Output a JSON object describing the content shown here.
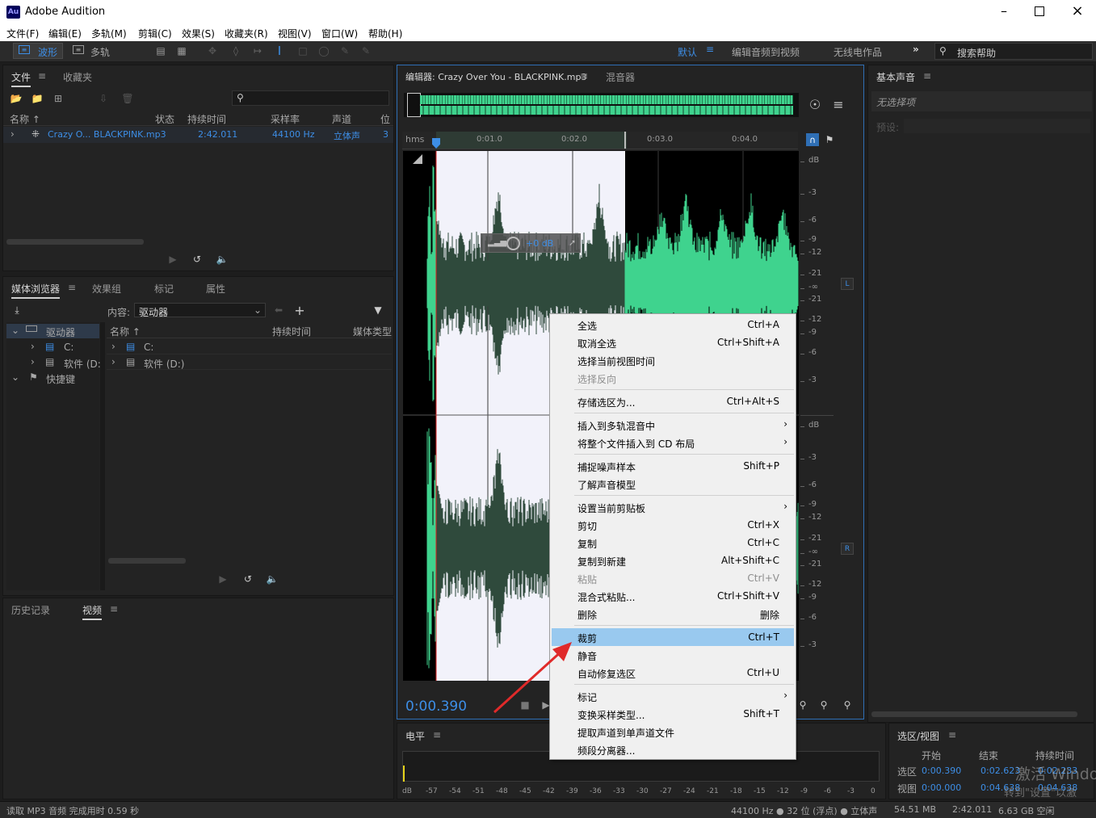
{
  "window": {
    "title": "Adobe Audition",
    "app_icon": "Au"
  },
  "menubar": [
    "文件(F)",
    "编辑(E)",
    "多轨(M)",
    "剪辑(C)",
    "效果(S)",
    "收藏夹(R)",
    "视图(V)",
    "窗口(W)",
    "帮助(H)"
  ],
  "toolbar": {
    "waveform": "波形",
    "multitrack": "多轨",
    "workspace_default": "默认",
    "ws_edit_video": "编辑音频到视频",
    "ws_radio": "无线电作品",
    "search_placeholder": "搜索帮助"
  },
  "files_panel": {
    "tabs": [
      "文件",
      "收藏夹"
    ],
    "columns": [
      "名称",
      "状态",
      "持续时间",
      "采样率",
      "声道",
      "位"
    ],
    "rows": [
      {
        "name": "Crazy O... BLACKPINK.mp3",
        "duration": "2:42.011",
        "rate": "44100 Hz",
        "channels": "立体声",
        "bits": "3"
      }
    ]
  },
  "media_panel": {
    "tabs": [
      "媒体浏览器",
      "效果组",
      "标记",
      "属性"
    ],
    "content_label": "内容:",
    "content_value": "驱动器",
    "tree": [
      "驱动器",
      "C:",
      "软件 (D:",
      "快捷键"
    ],
    "columns": [
      "名称",
      "持续时间",
      "媒体类型"
    ],
    "rows": [
      "C:",
      "软件 (D:)"
    ]
  },
  "history_panel": {
    "tabs": [
      "历史记录",
      "视频"
    ]
  },
  "editor": {
    "tab_editor": "编辑器: Crazy Over You - BLACKPINK.mp3",
    "tab_mixer": "混音器",
    "ruler_unit": "hms",
    "ruler_ticks": [
      "0:01.0",
      "0:02.0",
      "0:03.0",
      "0:04.0"
    ],
    "db_scale_top": [
      "dB",
      "-3",
      "-6",
      "-9",
      "-12",
      "-21",
      "-∞",
      "-21",
      "-12",
      "-9",
      "-6",
      "-3"
    ],
    "db_scale_bottom": [
      "dB",
      "-3",
      "-6",
      "-9",
      "-12",
      "-21",
      "-∞",
      "-21",
      "-12",
      "-9",
      "-6",
      "-3"
    ],
    "channel_left": "L",
    "channel_right": "R",
    "hud_gain": "+0 dB",
    "time_display": "0:00.390"
  },
  "context_menu": [
    {
      "label": "全选",
      "shortcut": "Ctrl+A"
    },
    {
      "label": "取消全选",
      "shortcut": "Ctrl+Shift+A"
    },
    {
      "label": "选择当前视图时间",
      "shortcut": ""
    },
    {
      "label": "选择反向",
      "shortcut": "",
      "disabled": true
    },
    {
      "sep": true
    },
    {
      "label": "存储选区为...",
      "shortcut": "Ctrl+Alt+S"
    },
    {
      "sep": true
    },
    {
      "label": "插入到多轨混音中",
      "shortcut": "",
      "submenu": true
    },
    {
      "label": "将整个文件插入到 CD 布局",
      "shortcut": "",
      "submenu": true
    },
    {
      "sep": true
    },
    {
      "label": "捕捉噪声样本",
      "shortcut": "Shift+P"
    },
    {
      "label": "了解声音模型",
      "shortcut": ""
    },
    {
      "sep": true
    },
    {
      "label": "设置当前剪贴板",
      "shortcut": "",
      "submenu": true
    },
    {
      "label": "剪切",
      "shortcut": "Ctrl+X"
    },
    {
      "label": "复制",
      "shortcut": "Ctrl+C"
    },
    {
      "label": "复制到新建",
      "shortcut": "Alt+Shift+C"
    },
    {
      "label": "粘贴",
      "shortcut": "Ctrl+V",
      "disabled": true
    },
    {
      "label": "混合式粘贴...",
      "shortcut": "Ctrl+Shift+V"
    },
    {
      "label": "删除",
      "shortcut": "删除"
    },
    {
      "sep": true
    },
    {
      "label": "裁剪",
      "shortcut": "Ctrl+T",
      "highlight": true
    },
    {
      "label": "静音",
      "shortcut": ""
    },
    {
      "label": "自动修复选区",
      "shortcut": "Ctrl+U"
    },
    {
      "sep": true
    },
    {
      "label": "标记",
      "shortcut": "",
      "submenu": true
    },
    {
      "label": "变换采样类型...",
      "shortcut": "Shift+T"
    },
    {
      "label": "提取声道到单声道文件",
      "shortcut": ""
    },
    {
      "label": "频段分离器...",
      "shortcut": ""
    }
  ],
  "essential_sound": {
    "title": "基本声音",
    "no_selection": "无选择项",
    "preset": "预设:"
  },
  "level_panel": {
    "title": "电平",
    "scale": [
      "dB",
      "-57",
      "-54",
      "-51",
      "-48",
      "-45",
      "-42",
      "-39",
      "-36",
      "-33",
      "-30",
      "-27",
      "-24",
      "-21",
      "-18",
      "-15",
      "-12",
      "-9",
      "-6",
      "-3",
      "0"
    ]
  },
  "selection_panel": {
    "title": "选区/视图",
    "col_start": "开始",
    "col_end": "结束",
    "col_duration": "持续时间",
    "row_selection": "选区",
    "row_view": "视图",
    "sel_start": "0:00.390",
    "sel_end": "0:02.623",
    "sel_dur": "0:02.233",
    "view_start": "0:00.000",
    "view_end": "0:04.638",
    "view_dur": "0:04.638"
  },
  "statusbar": {
    "left": "读取 MP3 音频 完成用时 0.59 秒",
    "format": "44100 Hz ● 32 位 (浮点) ● 立体声",
    "size": "54.51 MB",
    "duration": "2:42.011",
    "free": "6.63 GB 空闲"
  },
  "watermark": {
    "line1": "激活 Windo",
    "line2": "转到\"设置\"以激"
  },
  "colors": {
    "accent": "#3d8ee6",
    "waveform": "#3fd38e",
    "waveform_dim": "#2d4a3a",
    "selection_bg": "#f2f2fa",
    "menu_highlight": "#99c9ef",
    "arrow": "#e02a2a"
  }
}
